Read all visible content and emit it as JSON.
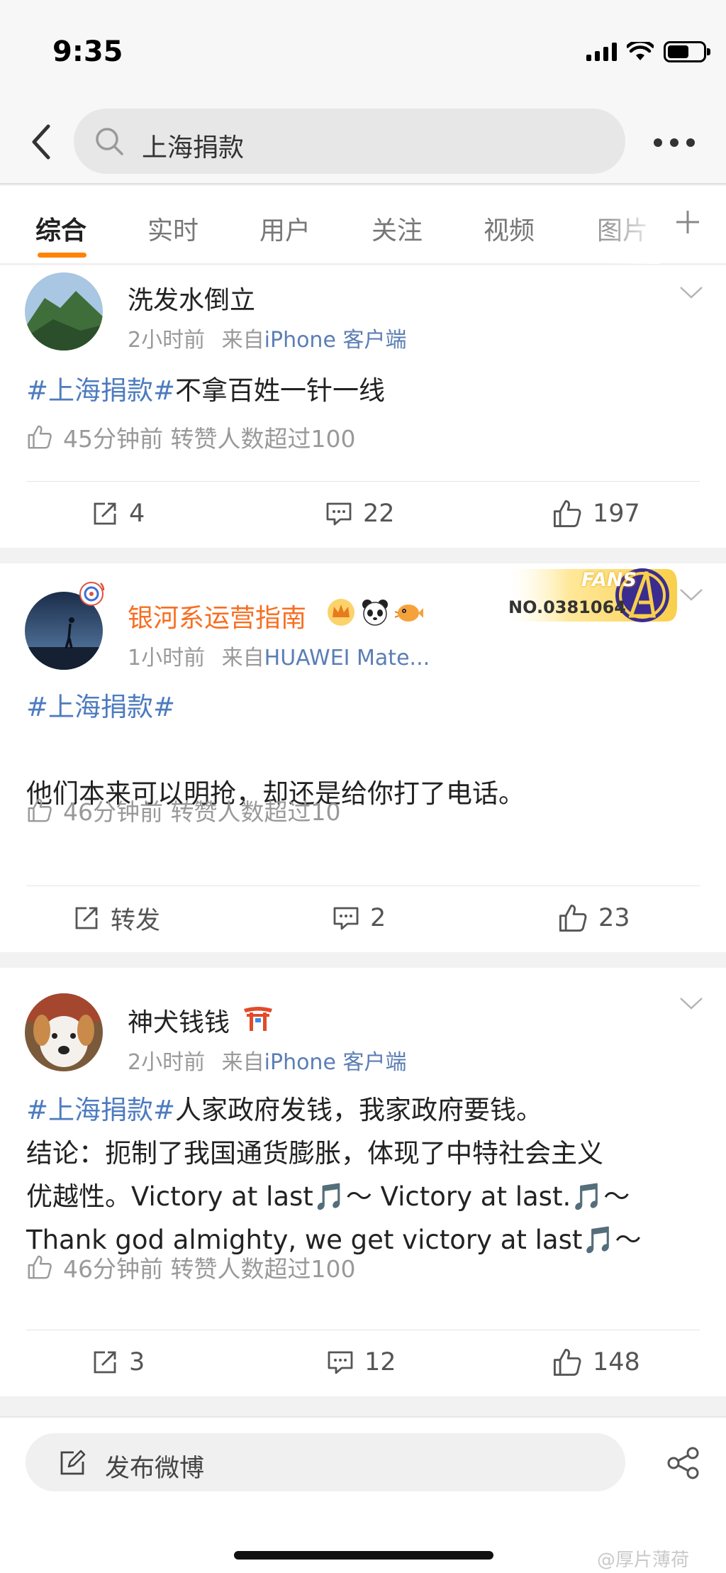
{
  "status_bar": {
    "time": "9:35",
    "battery_level": 0.6
  },
  "search": {
    "query": "上海捐款"
  },
  "tabs": [
    {
      "label": "综合",
      "active": true
    },
    {
      "label": "实时",
      "active": false
    },
    {
      "label": "用户",
      "active": false
    },
    {
      "label": "关注",
      "active": false
    },
    {
      "label": "视频",
      "active": false
    },
    {
      "label": "图片",
      "active": false
    }
  ],
  "posts": [
    {
      "username": "洗发水倒立",
      "time": "2小时前",
      "from_label": "来自",
      "source": "iPhone 客户端",
      "content": [
        {
          "tag": "#上海捐款#",
          "text": "不拿百姓一针一线"
        }
      ],
      "hot": "45分钟前 转赞人数超过100",
      "actions": {
        "repost": "4",
        "comment": "22",
        "like": "197"
      }
    },
    {
      "username": "银河系运营指南",
      "time": "1小时前",
      "from_label": "来自",
      "source": "HUAWEI Mate...",
      "fans_badge": {
        "title": "FANS",
        "number": "NO.0381064"
      },
      "content": [
        {
          "tag": "#上海捐款#",
          "text": ""
        },
        {
          "tag": "",
          "text": "他们本来可以明抢，却还是给你打了电话。"
        }
      ],
      "hot": "46分钟前 转赞人数超过10",
      "actions": {
        "repost": "转发",
        "comment": "2",
        "like": "23"
      }
    },
    {
      "username": "神犬钱钱",
      "time": "2小时前",
      "from_label": "来自",
      "source": "iPhone 客户端",
      "content": [
        {
          "tag": "#上海捐款#",
          "text": "人家政府发钱，我家政府要钱。"
        },
        {
          "tag": "",
          "text": "结论：扼制了我国通货膨胀，体现了中特社会主义"
        },
        {
          "tag": "",
          "text": "优越性。Victory at last🎵～ Victory at last.🎵～"
        },
        {
          "tag": "",
          "text": "Thank god almighty, we get victory at last🎵～"
        }
      ],
      "hot": "46分钟前 转赞人数超过100",
      "actions": {
        "repost": "3",
        "comment": "12",
        "like": "148"
      }
    }
  ],
  "bottom_bar": {
    "compose_label": "发布微博",
    "watermark": "@厚片薄荷"
  },
  "colors": {
    "accent": "#ff8200",
    "tag": "#4d7bbf",
    "vip_name": "#f86e21",
    "meta": "#999999"
  }
}
